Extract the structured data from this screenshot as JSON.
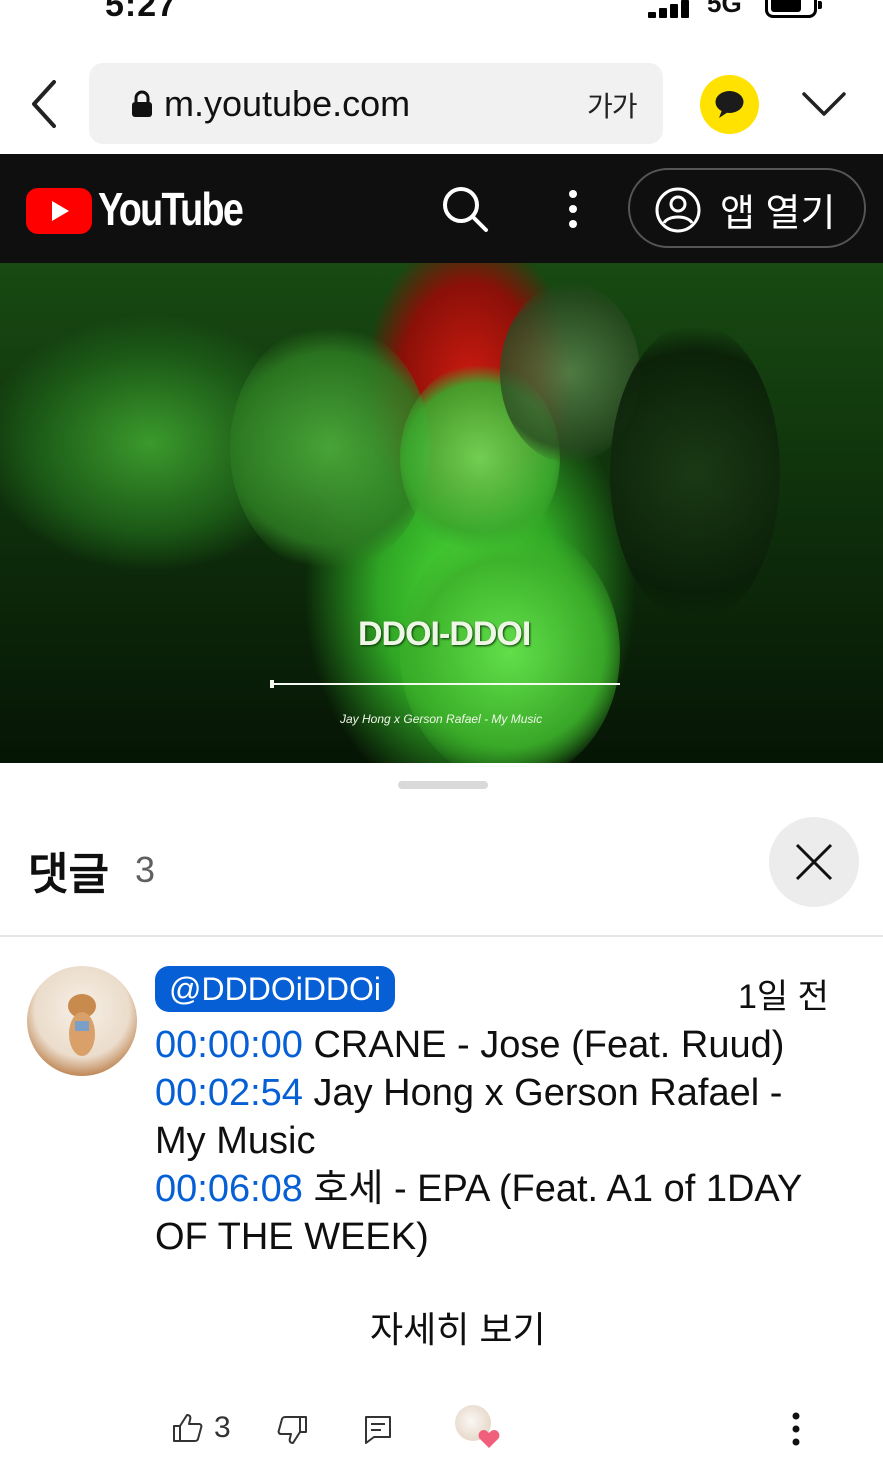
{
  "status_bar": {
    "time": "5:27",
    "network": "5G",
    "battery_level": 0.7
  },
  "browser": {
    "url": "m.youtube.com",
    "text_size": "가가",
    "icons": [
      "back-icon",
      "lock-icon",
      "kakao-talk-icon",
      "chevron-down-icon"
    ]
  },
  "youtube_header": {
    "logo_text": "YouTube",
    "open_app_label": "앱 열기",
    "icons": [
      "youtube-logo-icon",
      "search-icon",
      "more-vert-icon",
      "account-circle-icon"
    ]
  },
  "video": {
    "overlay_title": "DDOI-DDOI",
    "overlay_subtitle": "Jay Hong x Gerson Rafael - My Music"
  },
  "comments_panel": {
    "title": "댓글",
    "count": "3",
    "comment": {
      "author": "@DDDOiDDOi",
      "time": "1일 전",
      "lines": [
        {
          "timestamp": "00:00:00",
          "text": "CRANE - Jose (Feat. Ruud)"
        },
        {
          "timestamp": "00:02:54",
          "text": "Jay Hong x Gerson Rafael - My Music"
        },
        {
          "timestamp": "00:06:08",
          "text": "호세 - EPA (Feat. A1 of 1DAY OF THE WEEK)"
        }
      ],
      "read_more": "자세히 보기",
      "like_count": "3"
    },
    "colors": {
      "accent": "#065fd4",
      "heart": "#f0607a",
      "brand_red": "#ff0000"
    }
  }
}
